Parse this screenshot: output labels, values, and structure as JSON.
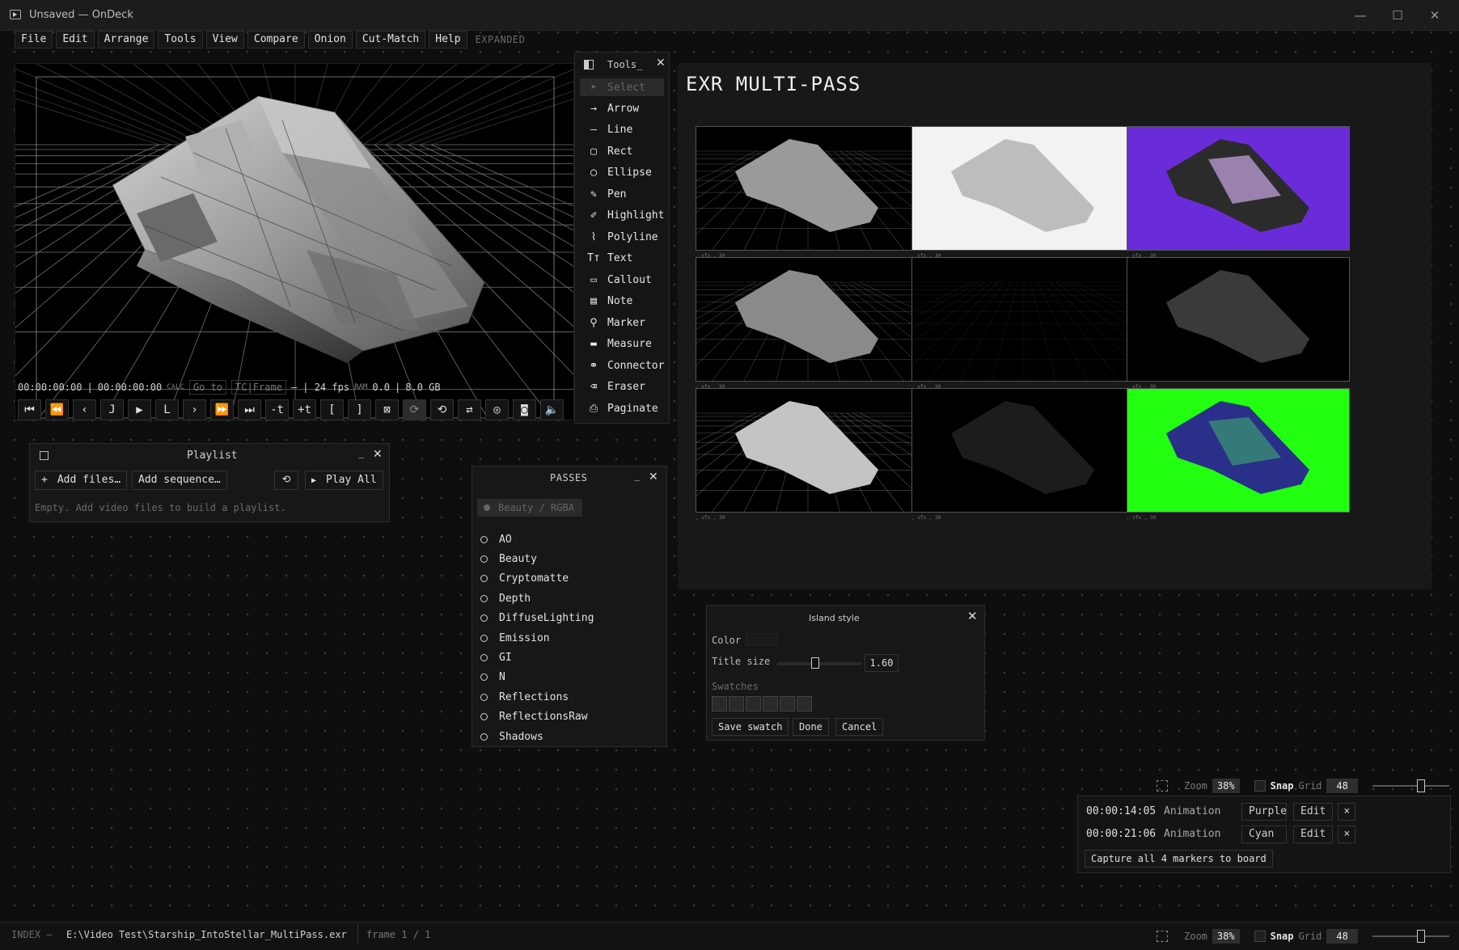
{
  "window": {
    "title": "Unsaved — OnDeck",
    "controls": {
      "minimize": "—",
      "maximize": "☐",
      "close": "✕"
    }
  },
  "menu": {
    "items": [
      "File",
      "Edit",
      "Arrange",
      "Tools",
      "View",
      "Compare",
      "Onion",
      "Cut-Match",
      "Help"
    ],
    "mode_label": "EXPANDED"
  },
  "viewer": {
    "timecode_current": "00:00:00:00",
    "separator": "|",
    "timecode_duration": "00:00:00:00",
    "calc_label": "CALC",
    "goto_placeholder": "Go to",
    "tc_frame_label": "TC|Frame",
    "fps_text": "— | 24 fps",
    "ram_label": "RAM",
    "ram_value": "0.0",
    "ram_pipe": "|",
    "memory": "8.0 GB",
    "transport": [
      {
        "name": "go-start",
        "glyph": "⏮"
      },
      {
        "name": "step-back-fast",
        "glyph": "⏪"
      },
      {
        "name": "step-back",
        "glyph": "‹"
      },
      {
        "name": "j",
        "glyph": "J"
      },
      {
        "name": "play",
        "glyph": "▶"
      },
      {
        "name": "l",
        "glyph": "L"
      },
      {
        "name": "step-forward",
        "glyph": "›"
      },
      {
        "name": "step-forward-fast",
        "glyph": "⏩"
      },
      {
        "name": "go-end",
        "glyph": "⏭"
      },
      {
        "name": "minus-t",
        "glyph": "-t"
      },
      {
        "name": "plus-t",
        "glyph": "+t"
      },
      {
        "name": "in-point",
        "glyph": "["
      },
      {
        "name": "out-point",
        "glyph": "]"
      },
      {
        "name": "clear-range",
        "glyph": "⊠"
      },
      {
        "name": "loop-range",
        "glyph": "⟳"
      },
      {
        "name": "loop",
        "glyph": "⟲"
      },
      {
        "name": "ping-pong",
        "glyph": "⇄"
      },
      {
        "name": "target",
        "glyph": "◎"
      },
      {
        "name": "snapshot",
        "glyph": "◙"
      },
      {
        "name": "volume",
        "glyph": "🔈"
      }
    ]
  },
  "tools": {
    "title": "Tools_",
    "close": "✕",
    "items": [
      {
        "label": "Select",
        "icon": "cursor-icon",
        "glyph": "➤",
        "selected": true
      },
      {
        "label": "Arrow",
        "icon": "arrow-icon",
        "glyph": "→"
      },
      {
        "label": "Line",
        "icon": "line-icon",
        "glyph": "—"
      },
      {
        "label": "Rect",
        "icon": "rect-icon",
        "glyph": "▢"
      },
      {
        "label": "Ellipse",
        "icon": "ellipse-icon",
        "glyph": "◯"
      },
      {
        "label": "Pen",
        "icon": "pen-icon",
        "glyph": "✎"
      },
      {
        "label": "Highlight",
        "icon": "highlight-icon",
        "glyph": "✐"
      },
      {
        "label": "Polyline",
        "icon": "polyline-icon",
        "glyph": "⌇"
      },
      {
        "label": "Text",
        "icon": "text-icon",
        "glyph": "Tт"
      },
      {
        "label": "Callout",
        "icon": "callout-icon",
        "glyph": "▭"
      },
      {
        "label": "Note",
        "icon": "note-icon",
        "glyph": "▤"
      },
      {
        "label": "Marker",
        "icon": "pin-icon",
        "glyph": "⚲"
      },
      {
        "label": "Measure",
        "icon": "ruler-icon",
        "glyph": "▬"
      },
      {
        "label": "Connector",
        "icon": "link-icon",
        "glyph": "⚭"
      },
      {
        "label": "Eraser",
        "icon": "eraser-icon",
        "glyph": "⌫"
      },
      {
        "label": "Paginate",
        "icon": "printer-icon",
        "glyph": "⎙"
      }
    ]
  },
  "board": {
    "title": "EXR MULTI-PASS",
    "thumbnails": [
      {
        "variant": "beauty-grid",
        "caption": ", vfx  , 30"
      },
      {
        "variant": "white-ao",
        "caption": ", vfx  , 30"
      },
      {
        "variant": "purple-crypto",
        "caption": ", vfx  , 30"
      },
      {
        "variant": "diffuse-grid",
        "caption": ", vfx  , 30"
      },
      {
        "variant": "dark-empty",
        "caption": ", vfx  , 30"
      },
      {
        "variant": "dark-ship",
        "caption": ", vfx  , 30"
      },
      {
        "variant": "bright-grid",
        "caption": ", vfx  , 30"
      },
      {
        "variant": "very-dark-ship",
        "caption": ", vfx  , 30"
      },
      {
        "variant": "green-normal",
        "caption": ", vfx  , 30"
      }
    ]
  },
  "playlist": {
    "title": "Playlist",
    "minimize": "_",
    "close": "✕",
    "add_files": "Add files…",
    "add_sequence": "Add sequence…",
    "play_all": "Play All",
    "empty_text": "Empty. Add video files to build a playlist."
  },
  "passes": {
    "title": "PASSES",
    "minimize": "_",
    "close": "✕",
    "current": "Beauty / RGBA",
    "items": [
      "AO",
      "Beauty",
      "Cryptomatte",
      "Depth",
      "DiffuseLighting",
      "Emission",
      "GI",
      "N",
      "Reflections",
      "ReflectionsRaw",
      "Shadows"
    ]
  },
  "island_style": {
    "title": "Island style",
    "close": "✕",
    "color_label": "Color",
    "title_size_label": "Title size",
    "title_size_value": "1.60",
    "title_size_fraction": 0.45,
    "swatches_label": "Swatches",
    "swatch_count": 6,
    "save_swatch": "Save swatch",
    "done": "Done",
    "cancel": "Cancel"
  },
  "markers": {
    "zoom_label": "Zoom",
    "zoom_value": "38%",
    "snap_label": "Snap",
    "grid_label": "Grid",
    "grid_value": "48",
    "rows": [
      {
        "time": "00:00:14:05",
        "category": "Animation",
        "color": "Purple",
        "edit": "Edit",
        "remove": "×"
      },
      {
        "time": "00:00:21:06",
        "category": "Animation",
        "color": "Cyan",
        "edit": "Edit",
        "remove": "×"
      }
    ],
    "capture_button": "Capture all 4 markers to board"
  },
  "footer": {
    "index_label": "INDEX —",
    "path": "E:\\Video Test\\Starship_IntoStellar_MultiPass.exr",
    "frame_text": "frame 1 / 1",
    "zoom_label": "Zoom",
    "zoom_value": "38%",
    "snap_label": "Snap",
    "grid_label": "Grid",
    "grid_value": "48"
  }
}
